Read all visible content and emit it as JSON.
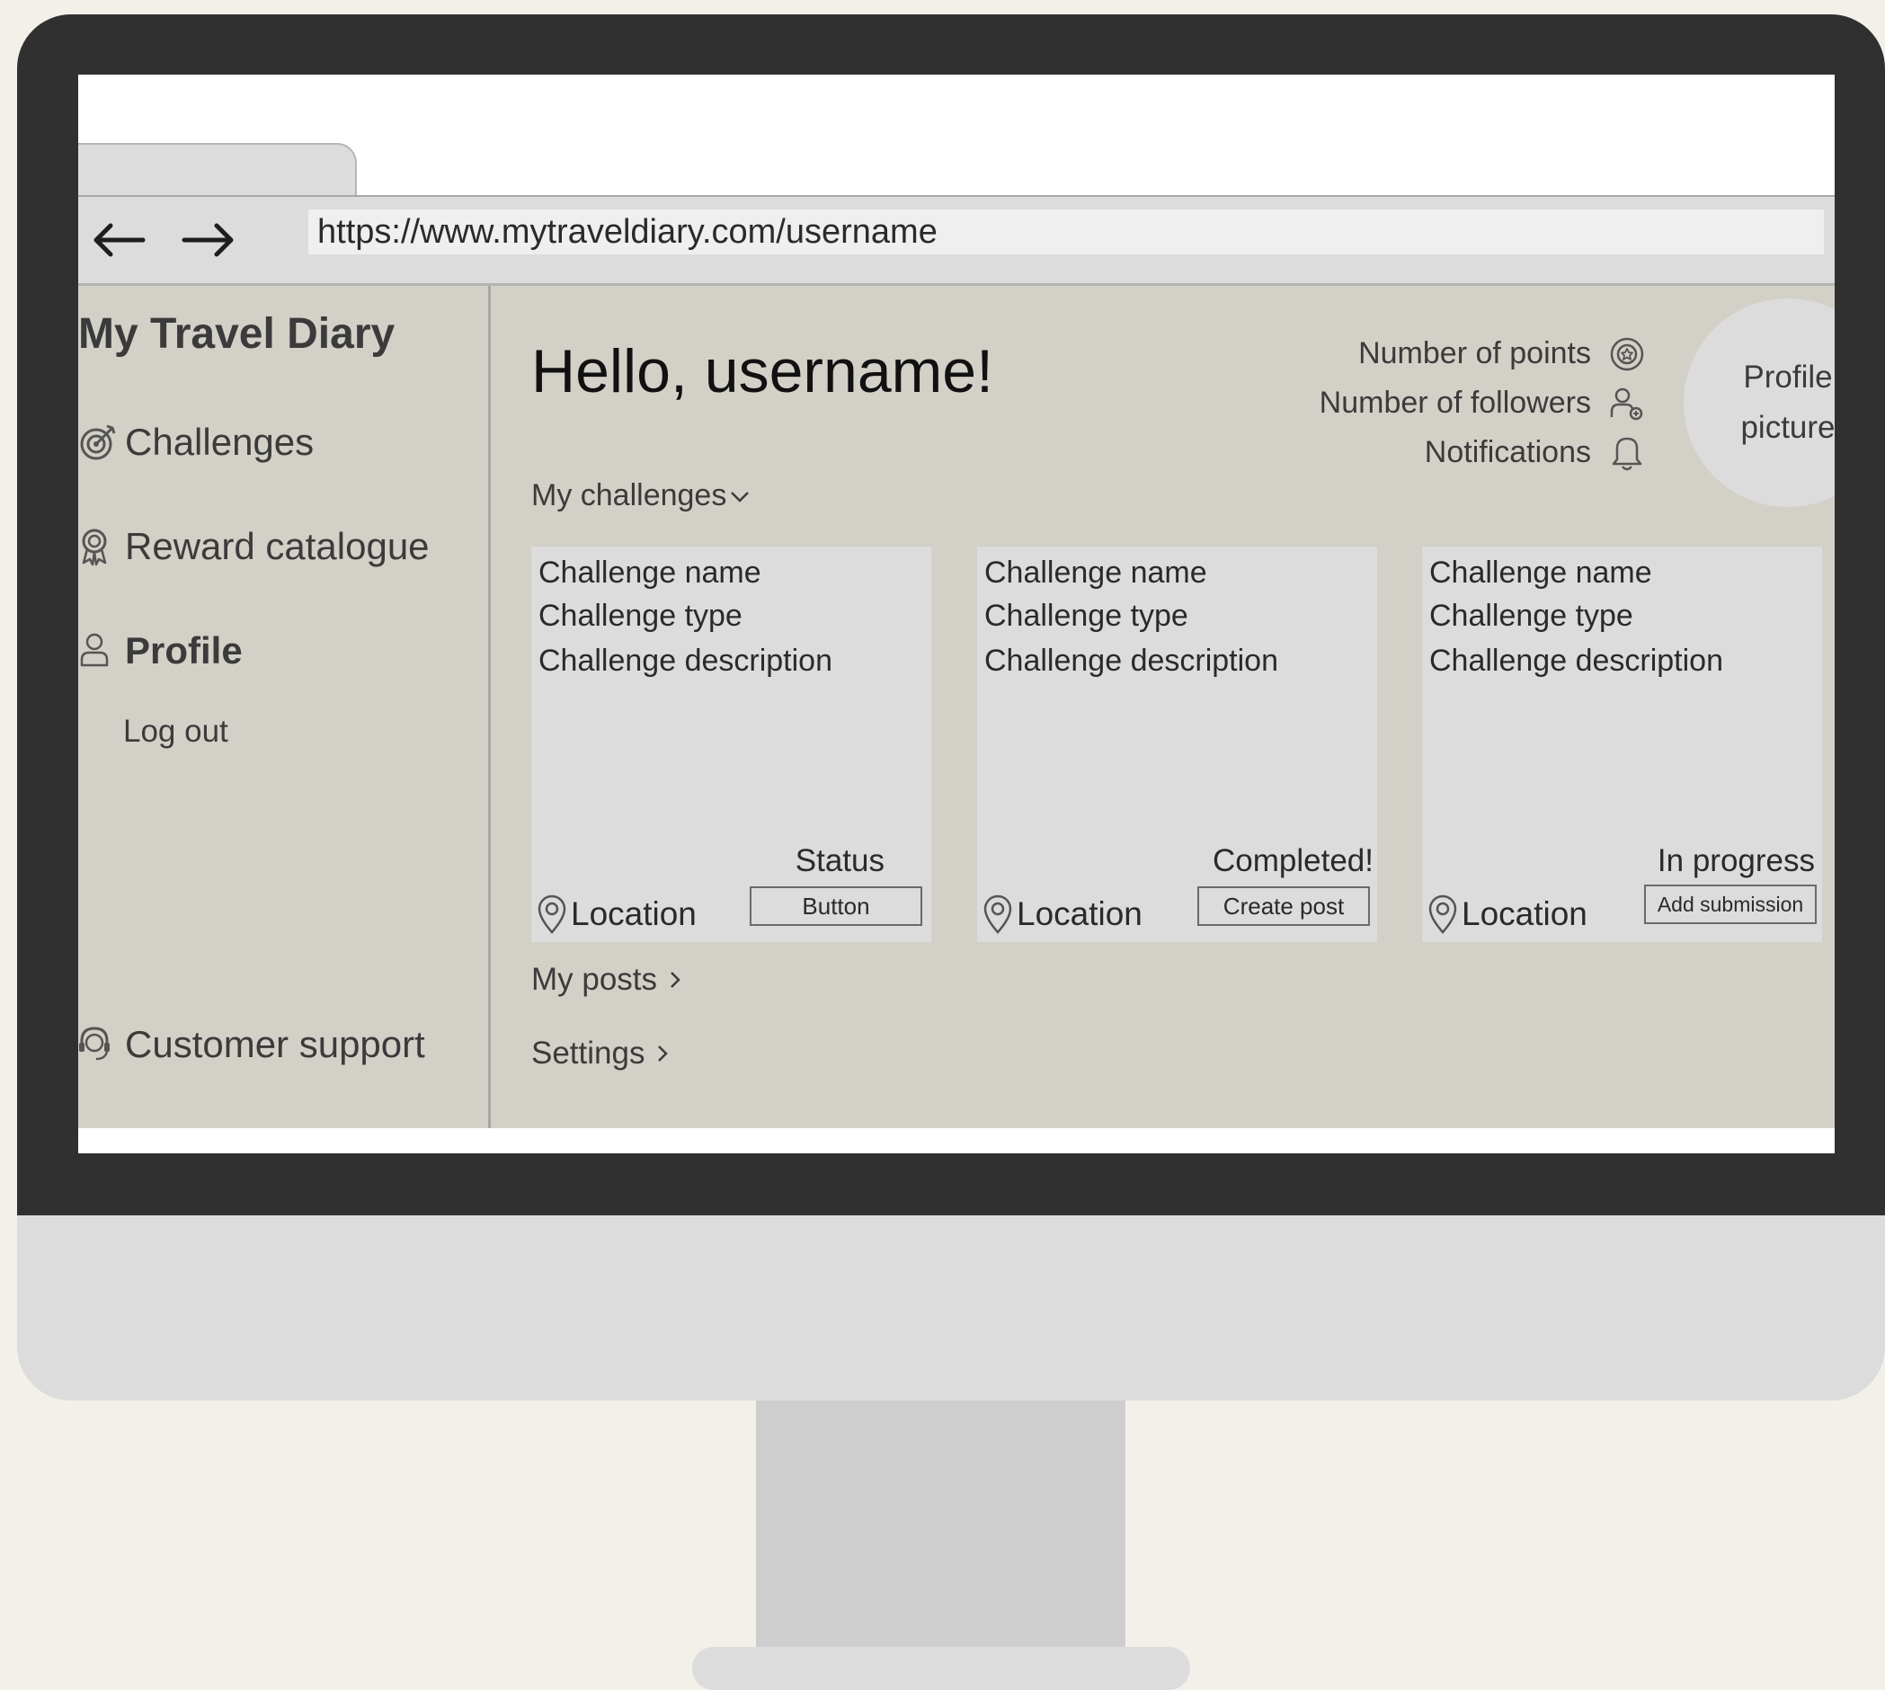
{
  "browser": {
    "url": "https://www.mytraveldiary.com/username"
  },
  "sidebar": {
    "brand": "My Travel Diary",
    "items": [
      {
        "label": "Challenges",
        "icon": "target-icon"
      },
      {
        "label": "Reward catalogue",
        "icon": "award-icon"
      },
      {
        "label": "Profile",
        "icon": "user-icon"
      },
      {
        "label": "Log out"
      }
    ],
    "support": {
      "label": "Customer support",
      "icon": "headset-icon"
    }
  },
  "header": {
    "greeting": "Hello, username!",
    "stats": [
      {
        "label": "Number of points",
        "icon": "points-icon"
      },
      {
        "label": "Number of followers",
        "icon": "followers-icon"
      },
      {
        "label": "Notifications",
        "icon": "bell-icon"
      }
    ],
    "profile_picture": "Profile picture"
  },
  "challenges": {
    "label": "My challenges",
    "cards": [
      {
        "name": "Challenge name",
        "type": "Challenge type",
        "description": "Challenge description",
        "status": "Status",
        "location": "Location",
        "button": "Button"
      },
      {
        "name": "Challenge name",
        "type": "Challenge type",
        "description": "Challenge description",
        "status": "Completed!",
        "location": "Location",
        "button": "Create post"
      },
      {
        "name": "Challenge name",
        "type": "Challenge type",
        "description": "Challenge description",
        "status": "In progress",
        "location": "Location",
        "button": "Add submission"
      }
    ]
  },
  "links": {
    "posts": "My posts",
    "settings": "Settings"
  }
}
